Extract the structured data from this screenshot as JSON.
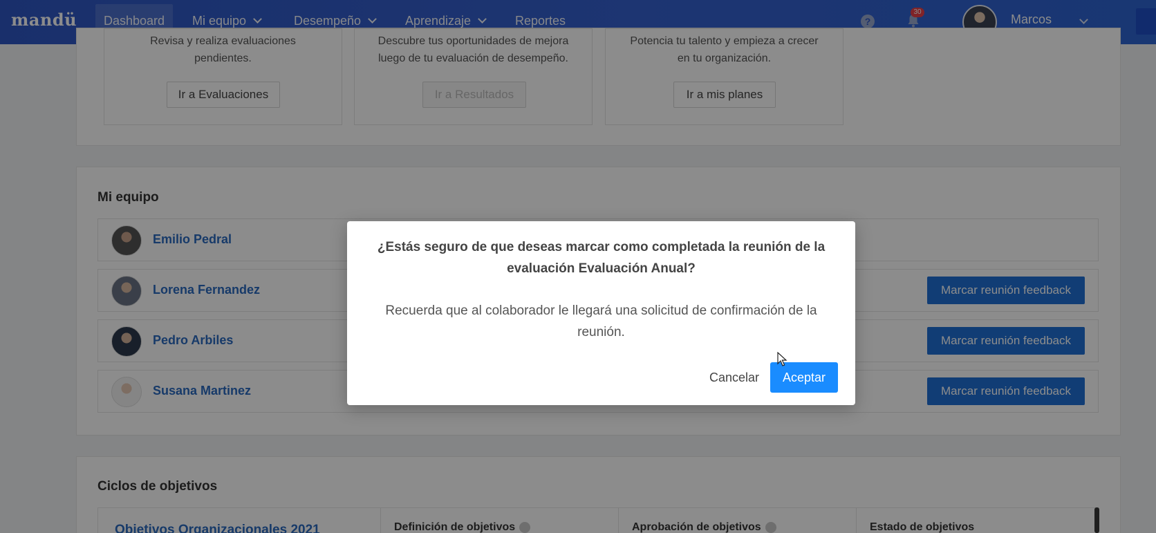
{
  "nav": {
    "logo": "mandü",
    "items": [
      {
        "label": "Dashboard",
        "active": true,
        "dropdown": false
      },
      {
        "label": "Mi equipo",
        "active": false,
        "dropdown": true
      },
      {
        "label": "Desempeño",
        "active": false,
        "dropdown": true
      },
      {
        "label": "Aprendizaje",
        "active": false,
        "dropdown": true
      },
      {
        "label": "Reportes",
        "active": false,
        "dropdown": false
      }
    ],
    "help_icon": "question-icon",
    "notifications_count": "30",
    "user_name": "Marcos"
  },
  "top_cards": [
    {
      "line1": "Revisa y realiza evaluaciones",
      "line2": "pendientes.",
      "button": "Ir a Evaluaciones",
      "disabled": false
    },
    {
      "line1": "Descubre tus oportunidades de mejora",
      "line2": "luego de tu evaluación de desempeño.",
      "button": "Ir a Resultados",
      "disabled": true
    },
    {
      "line1": "Potencia tu talento y empieza a crecer",
      "line2": "en tu organización.",
      "button": "Ir a mis planes",
      "disabled": false
    }
  ],
  "team": {
    "title": "Mi equipo",
    "members": [
      {
        "name": "Emilio Pedral",
        "has_button": false
      },
      {
        "name": "Lorena Fernandez",
        "has_button": true
      },
      {
        "name": "Pedro Arbiles",
        "has_button": true
      },
      {
        "name": "Susana Martinez",
        "has_button": true
      }
    ],
    "feedback_button": "Marcar reunión feedback"
  },
  "objectives": {
    "title": "Ciclos de objetivos",
    "cycle_name": "Objetivos Organizacionales 2021",
    "columns": [
      "Definición de objetivos",
      "Aprobación de objetivos",
      "Estado de objetivos"
    ]
  },
  "modal": {
    "title": "¿Estás seguro de que deseas marcar como completada la reunión de la evaluación Evaluación Anual?",
    "body": "Recuerda que al colaborador le llegará una solicitud de confirmación de la reunión.",
    "cancel": "Cancelar",
    "accept": "Aceptar"
  },
  "colors": {
    "nav_bg": "#2f57c4",
    "primary": "#1a8cff",
    "feedback_btn": "#1f70d6",
    "link": "#2a6ac0",
    "badge": "#e9414a"
  }
}
